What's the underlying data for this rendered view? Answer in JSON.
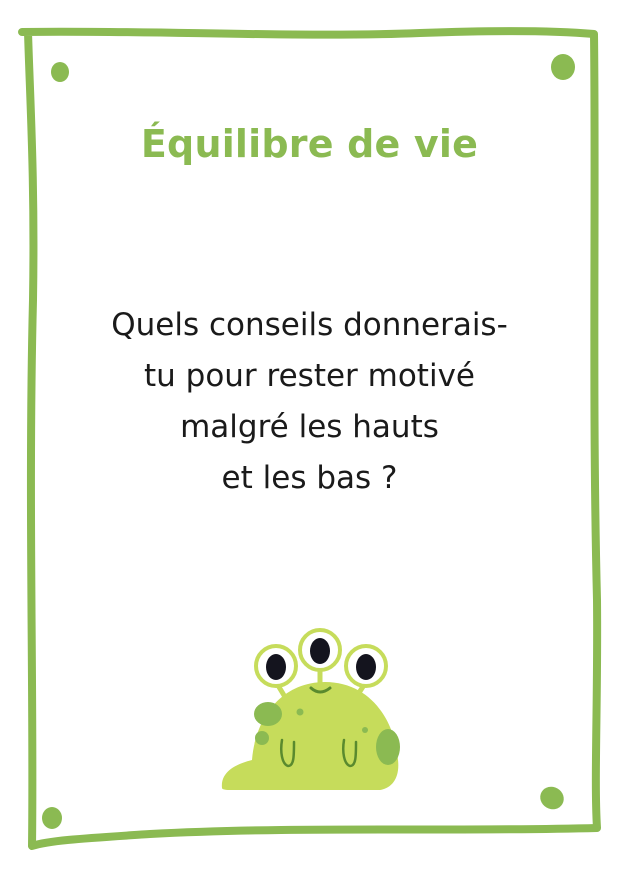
{
  "card": {
    "title": "Équilibre de vie",
    "question_lines": [
      "Quels conseils donnerais-",
      "tu pour rester motivé",
      "malgré les hauts",
      "et les bas ?"
    ]
  },
  "colors": {
    "accent": "#8bba52",
    "monster_body": "#c6dc5b",
    "monster_spots": "#8bba52",
    "eye_pupil": "#14141e",
    "question_text": "#1a1a1a",
    "background": "#ffffff"
  },
  "decoration": {
    "frame": "hand-drawn-green-border",
    "corner_dots": "green-dot-icon",
    "mascot": "three-eyed-slime-monster"
  }
}
